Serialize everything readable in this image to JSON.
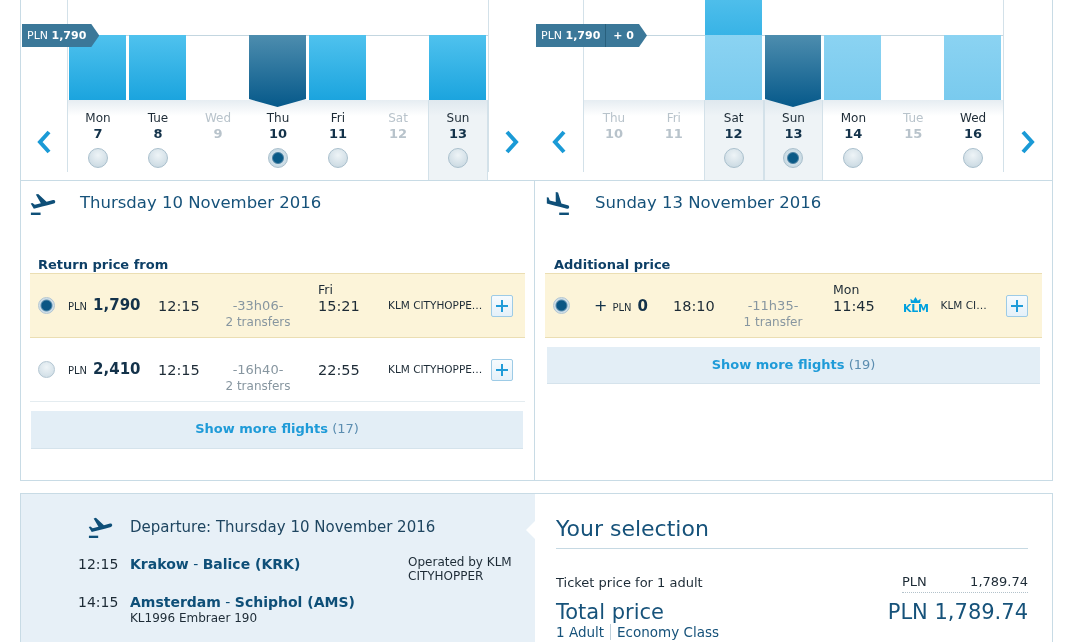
{
  "outbound_calendar": {
    "kind": "outbound",
    "price_tag": {
      "price": "PLN **1,790**"
    },
    "days": [
      {
        "weekday": "Mon",
        "date": "7",
        "above_lowest": false,
        "selected": false,
        "disabled": false,
        "shaded": false
      },
      {
        "weekday": "Tue",
        "date": "8",
        "above_lowest": false,
        "selected": false,
        "disabled": false,
        "shaded": false
      },
      {
        "weekday": "Wed",
        "date": "9",
        "selected": false,
        "disabled": true,
        "shaded": false
      },
      {
        "weekday": "Thu",
        "date": "10",
        "above_lowest": false,
        "selected": true,
        "disabled": false,
        "shaded": false
      },
      {
        "weekday": "Fri",
        "date": "11",
        "above_lowest": false,
        "selected": false,
        "disabled": false,
        "shaded": false
      },
      {
        "weekday": "Sat",
        "date": "12",
        "selected": false,
        "disabled": true,
        "shaded": false
      },
      {
        "weekday": "Sun",
        "date": "13",
        "above_lowest": false,
        "selected": false,
        "disabled": false,
        "shaded": true
      }
    ]
  },
  "return_calendar": {
    "kind": "return",
    "price_tag": {
      "price": "PLN **1,790**",
      "difference": "+ 0"
    },
    "days": [
      {
        "weekday": "Thu",
        "date": "10",
        "selected": false,
        "disabled": true,
        "shaded": false
      },
      {
        "weekday": "Fri",
        "date": "11",
        "selected": false,
        "disabled": true,
        "shaded": false
      },
      {
        "weekday": "Sat",
        "date": "12",
        "above_lowest": true,
        "selected": false,
        "disabled": false,
        "shaded": true
      },
      {
        "weekday": "Sun",
        "date": "13",
        "above_lowest": false,
        "selected": true,
        "disabled": false,
        "shaded": true
      },
      {
        "weekday": "Mon",
        "date": "14",
        "above_lowest": false,
        "selected": false,
        "disabled": false,
        "shaded": false
      },
      {
        "weekday": "Tue",
        "date": "15",
        "selected": false,
        "disabled": true,
        "shaded": false
      },
      {
        "weekday": "Wed",
        "date": "16",
        "above_lowest": false,
        "selected": false,
        "disabled": false,
        "shaded": false
      }
    ]
  },
  "outbound_flights": {
    "kind": "departure",
    "date_title": "Thursday 10 November 2016",
    "price_label": "Return price from",
    "flights": [
      {
        "selected": true,
        "currency": "PLN",
        "price": "1,790",
        "departure": "12:15",
        "duration": "-33h06-",
        "transfers": "2 transfers",
        "arrival_day": "Fri",
        "arrival": "15:21",
        "airline": "KLM CITYHOPPE…"
      },
      {
        "selected": false,
        "currency": "PLN",
        "price": "2,410",
        "departure": "12:15",
        "duration": "-16h40-",
        "transfers": "2 transfers",
        "arrival": "22:55",
        "airline": "KLM CITYHOPPE…"
      }
    ],
    "show_more": {
      "label": "Show more flights",
      "count": "(17)"
    }
  },
  "return_flights": {
    "kind": "arrival",
    "date_title": "Sunday 13 November 2016",
    "price_label": "Additional price",
    "flights": [
      {
        "selected": true,
        "sign": "+",
        "currency": "PLN",
        "price": "0",
        "departure": "18:10",
        "duration": "-11h35-",
        "transfers": "1 transfer",
        "arrival_day": "Mon",
        "arrival": "11:45",
        "logo": "KLM",
        "airline": "KLM CI…"
      }
    ],
    "show_more": {
      "label": "Show more flights",
      "count": "(19)"
    }
  },
  "itinerary": {
    "kind": "departure",
    "title": "Departure: Thursday 10 November 2016",
    "stops": [
      {
        "time": "12:15",
        "place": "**Krakow** - **Balice (KRK)**"
      },
      {
        "time": "14:15",
        "place": "**Amsterdam** - **Schiphol (AMS)**",
        "detail": "KL1996 Embraer 190"
      }
    ],
    "operator": "Operated by KLM CITYHOPPER"
  },
  "selection": {
    "title": "Your selection",
    "ticket_label": "Ticket price for 1 adult",
    "ticket_currency": "PLN",
    "ticket_amount": "1,789.74",
    "total_label": "Total price",
    "total_amount": "PLN 1,789.74",
    "passengers": "1 Adult",
    "cabin": "Economy Class"
  }
}
